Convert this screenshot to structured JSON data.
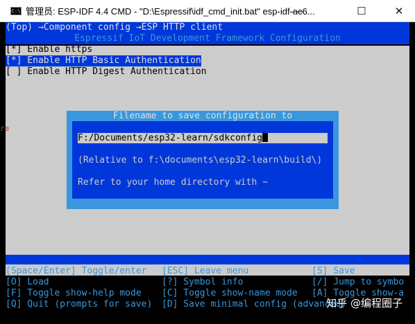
{
  "window": {
    "title": "管理员: ESP-IDF 4.4 CMD - \"D:\\Espressif\\idf_cmd_init.bat\"  esp-idf-ac6...",
    "icon_label": "C:\\",
    "minimize": "—",
    "maximize": "☐",
    "close": "✕"
  },
  "breadcrumb": "(Top) →Component config →ESP HTTP client",
  "header_title": "Espressif IoT Development Framework Configuration",
  "menu": {
    "items": [
      {
        "label": "[*] Enable https",
        "selected": false
      },
      {
        "label": "[*] Enable HTTP Basic Authentication",
        "selected": true
      },
      {
        "label": "[ ] Enable HTTP Digest Authentication",
        "selected": false
      }
    ]
  },
  "dialog": {
    "title": "Filename to save configuration to",
    "input_value": "F:/Documents/esp32-learn/sdkconfig",
    "relative_text": "(Relative to f:\\documents\\esp32-learn\\build\\)",
    "home_text": "Refer to your home directory with ~"
  },
  "help": {
    "rows": [
      [
        "[Space/Enter] Toggle/enter",
        "[ESC] Leave menu",
        "[S] Save"
      ],
      [
        "[O] Load",
        "[?] Symbol info",
        "[/] Jump to symbo"
      ],
      [
        "[F] Toggle show-help mode",
        "[C] Toggle show-name mode",
        "[A] Toggle show-a"
      ],
      [
        "[Q] Quit (prompts for save)",
        "[D] Save minimal config (advanced)",
        ""
      ]
    ]
  },
  "left_edge_mark": "re",
  "watermark": "知乎 @编程圈子",
  "colors": {
    "console_bg": "#000000",
    "menu_bg": "#cccccc",
    "dialog_blue": "#0037da",
    "dialog_border": "#3a96dd",
    "help_text": "#3a96dd"
  }
}
